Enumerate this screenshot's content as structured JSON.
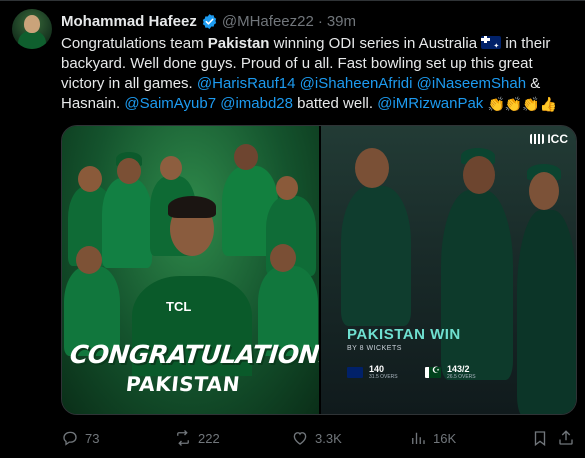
{
  "tweet": {
    "author_name": "Mohammad Hafeez",
    "handle": "@MHafeez22",
    "separator": "·",
    "time": "39m",
    "text_parts": [
      {
        "t": "Congratulations team ",
        "k": "plain"
      },
      {
        "t": "Pakistan",
        "k": "bold"
      },
      {
        "t": " winning ODI series in Australia ",
        "k": "plain"
      },
      {
        "t": " in their backyard. Well done guys. Proud of u all. Fast bowling set up this great victory in all games. ",
        "k": "plain"
      },
      {
        "t": "@HarisRauf14",
        "k": "mention"
      },
      {
        "t": "@iShaheenAfridi",
        "k": "mention"
      },
      {
        "t": "@iNaseemShah",
        "k": "mention"
      },
      {
        "t": " & Hasnain. ",
        "k": "plain"
      },
      {
        "t": "@SaimAyub7",
        "k": "mention"
      },
      {
        "t": "@imabd28",
        "k": "mention"
      },
      {
        "t": " batted well. ",
        "k": "plain"
      },
      {
        "t": "@iMRizwanPak",
        "k": "mention"
      },
      {
        "t": "👏👏👏👍",
        "k": "emoji"
      }
    ],
    "australia_flag_icon": "australia-flag-icon"
  },
  "media": {
    "left_image": {
      "headline": "CONGRATULATIONS!",
      "subline": "PAKISTAN",
      "sponsor": "TCL"
    },
    "right_image": {
      "brand": "ICC",
      "result_title": "PAKISTAN WIN",
      "result_sub": "BY 8 WICKETS",
      "team1_score": "140",
      "team1_overs": "31.5 OVERS",
      "team2_score": "143/2",
      "team2_overs": "26.5 OVERS"
    }
  },
  "actions": {
    "replies": "73",
    "reposts": "222",
    "likes": "3.3K",
    "views": "16K"
  },
  "colors": {
    "background": "#000000",
    "text": "#e7e9ea",
    "muted": "#71767b",
    "accent": "#1d9bf0",
    "verified": "#1d9bf0"
  }
}
